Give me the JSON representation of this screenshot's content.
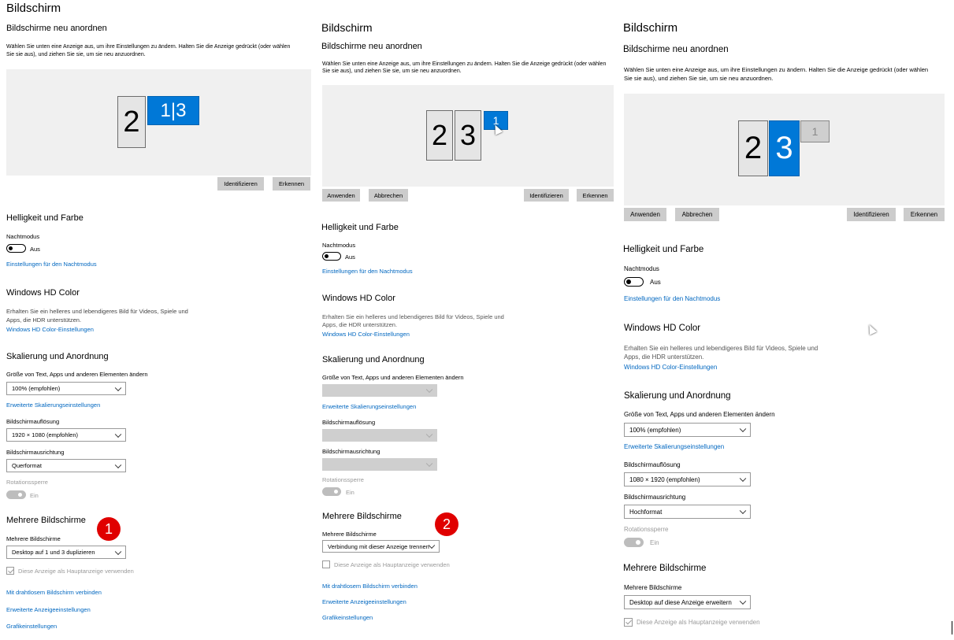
{
  "panels": [
    {
      "title": "Bildschirm",
      "rearrange_heading": "Bildschirme neu anordnen",
      "rearrange_desc_1": "Wählen Sie unten eine Anzeige aus, um ihre Einstellungen zu ändern. Halten Sie die Anzeige gedrückt (oder wählen",
      "rearrange_desc_2": "Sie sie aus), und ziehen Sie sie, um sie neu anzuordnen.",
      "monitors": [
        "2",
        "1|3"
      ],
      "buttons": {
        "identify": "Identifizieren",
        "detect": "Erkennen"
      },
      "brightness_heading": "Helligkeit und Farbe",
      "night_label": "Nachtmodus",
      "night_state": "Aus",
      "night_link": "Einstellungen für den Nachtmodus",
      "hd_heading": "Windows HD Color",
      "hd_desc_1": "Erhalten Sie ein helleres und lebendigeres Bild für Videos, Spiele und",
      "hd_desc_2": "Apps, die HDR unterstützen.",
      "hd_link": "Windows HD Color-Einstellungen",
      "scale_heading": "Skalierung und Anordnung",
      "scale_label": "Größe von Text, Apps und anderen Elementen ändern",
      "scale_value": "100% (empfohlen)",
      "scale_link": "Erweiterte Skalierungseinstellungen",
      "res_label": "Bildschirmauflösung",
      "res_value": "1920 × 1080 (empfohlen)",
      "orient_label": "Bildschirmausrichtung",
      "orient_value": "Querformat",
      "rot_label": "Rotationssperre",
      "rot_state": "Ein",
      "multi_heading": "Mehrere Bildschirme",
      "multi_label": "Mehrere Bildschirme",
      "multi_value": "Desktop auf 1 und 3 duplizieren",
      "main_display": "Diese Anzeige als Hauptanzeige verwenden",
      "wireless_link": "Mit drahtlosem Bildschirm verbinden",
      "adv_display_link": "Erweiterte Anzeigeeinstellungen",
      "graphics_link": "Grafikeinstellungen",
      "badge": "1"
    },
    {
      "title": "Bildschirm",
      "rearrange_heading": "Bildschirme neu anordnen",
      "rearrange_desc_1": "Wählen Sie unten eine Anzeige aus, um ihre Einstellungen zu ändern. Halten Sie die Anzeige gedrückt (oder wählen",
      "rearrange_desc_2": "Sie sie aus), und ziehen Sie sie, um sie neu anzuordnen.",
      "monitors": [
        "2",
        "3",
        "1"
      ],
      "buttons": {
        "apply": "Anwenden",
        "cancel": "Abbrechen",
        "identify": "Identifizieren",
        "detect": "Erkennen"
      },
      "brightness_heading": "Helligkeit und Farbe",
      "night_label": "Nachtmodus",
      "night_state": "Aus",
      "night_link": "Einstellungen für den Nachtmodus",
      "hd_heading": "Windows HD Color",
      "hd_desc_1": "Erhalten Sie ein helleres und lebendigeres Bild für Videos, Spiele und",
      "hd_desc_2": "Apps, die HDR unterstützen.",
      "hd_link": "Windows HD Color-Einstellungen",
      "scale_heading": "Skalierung und Anordnung",
      "scale_label": "Größe von Text, Apps und anderen Elementen ändern",
      "scale_link": "Erweiterte Skalierungseinstellungen",
      "res_label": "Bildschirmauflösung",
      "orient_label": "Bildschirmausrichtung",
      "rot_label": "Rotationssperre",
      "rot_state": "Ein",
      "multi_heading": "Mehrere Bildschirme",
      "multi_label": "Mehrere Bildschirme",
      "multi_value": "Verbindung mit dieser Anzeige trennen",
      "main_display": "Diese Anzeige als Hauptanzeige verwenden",
      "wireless_link": "Mit drahtlosem Bildschirm verbinden",
      "adv_display_link": "Erweiterte Anzeigeeinstellungen",
      "graphics_link": "Grafikeinstellungen",
      "badge": "2"
    },
    {
      "title": "Bildschirm",
      "rearrange_heading": "Bildschirme neu anordnen",
      "rearrange_desc_1": "Wählen Sie unten eine Anzeige aus, um ihre Einstellungen zu ändern. Halten Sie die Anzeige gedrückt (oder wählen",
      "rearrange_desc_2": "Sie sie aus), und ziehen Sie sie, um sie neu anzuordnen.",
      "monitors": [
        "2",
        "3",
        "1"
      ],
      "buttons": {
        "apply": "Anwenden",
        "cancel": "Abbrechen",
        "identify": "Identifizieren",
        "detect": "Erkennen"
      },
      "brightness_heading": "Helligkeit und Farbe",
      "night_label": "Nachtmodus",
      "night_state": "Aus",
      "night_link": "Einstellungen für den Nachtmodus",
      "hd_heading": "Windows HD Color",
      "hd_desc_1": "Erhalten Sie ein helleres und lebendigeres Bild für Videos, Spiele und",
      "hd_desc_2": "Apps, die HDR unterstützen.",
      "hd_link": "Windows HD Color-Einstellungen",
      "scale_heading": "Skalierung und Anordnung",
      "scale_label": "Größe von Text, Apps und anderen Elementen ändern",
      "scale_value": "100% (empfohlen)",
      "scale_link": "Erweiterte Skalierungseinstellungen",
      "res_label": "Bildschirmauflösung",
      "res_value": "1080 × 1920 (empfohlen)",
      "orient_label": "Bildschirmausrichtung",
      "orient_value": "Hochformat",
      "rot_label": "Rotationssperre",
      "rot_state": "Ein",
      "multi_heading": "Mehrere Bildschirme",
      "multi_label": "Mehrere Bildschirme",
      "multi_value": "Desktop auf diese Anzeige erweitern",
      "main_display": "Diese Anzeige als Hauptanzeige verwenden"
    }
  ],
  "colors": {
    "accent_link": "#0067c0",
    "monitor_selected": "#0078d7",
    "badge": "#e00000",
    "canvas": "#f0f0f0",
    "button": "#cccccc"
  },
  "icons": [
    "chevron-down-icon",
    "checkmark-icon",
    "mouse-pointer-icon"
  ]
}
